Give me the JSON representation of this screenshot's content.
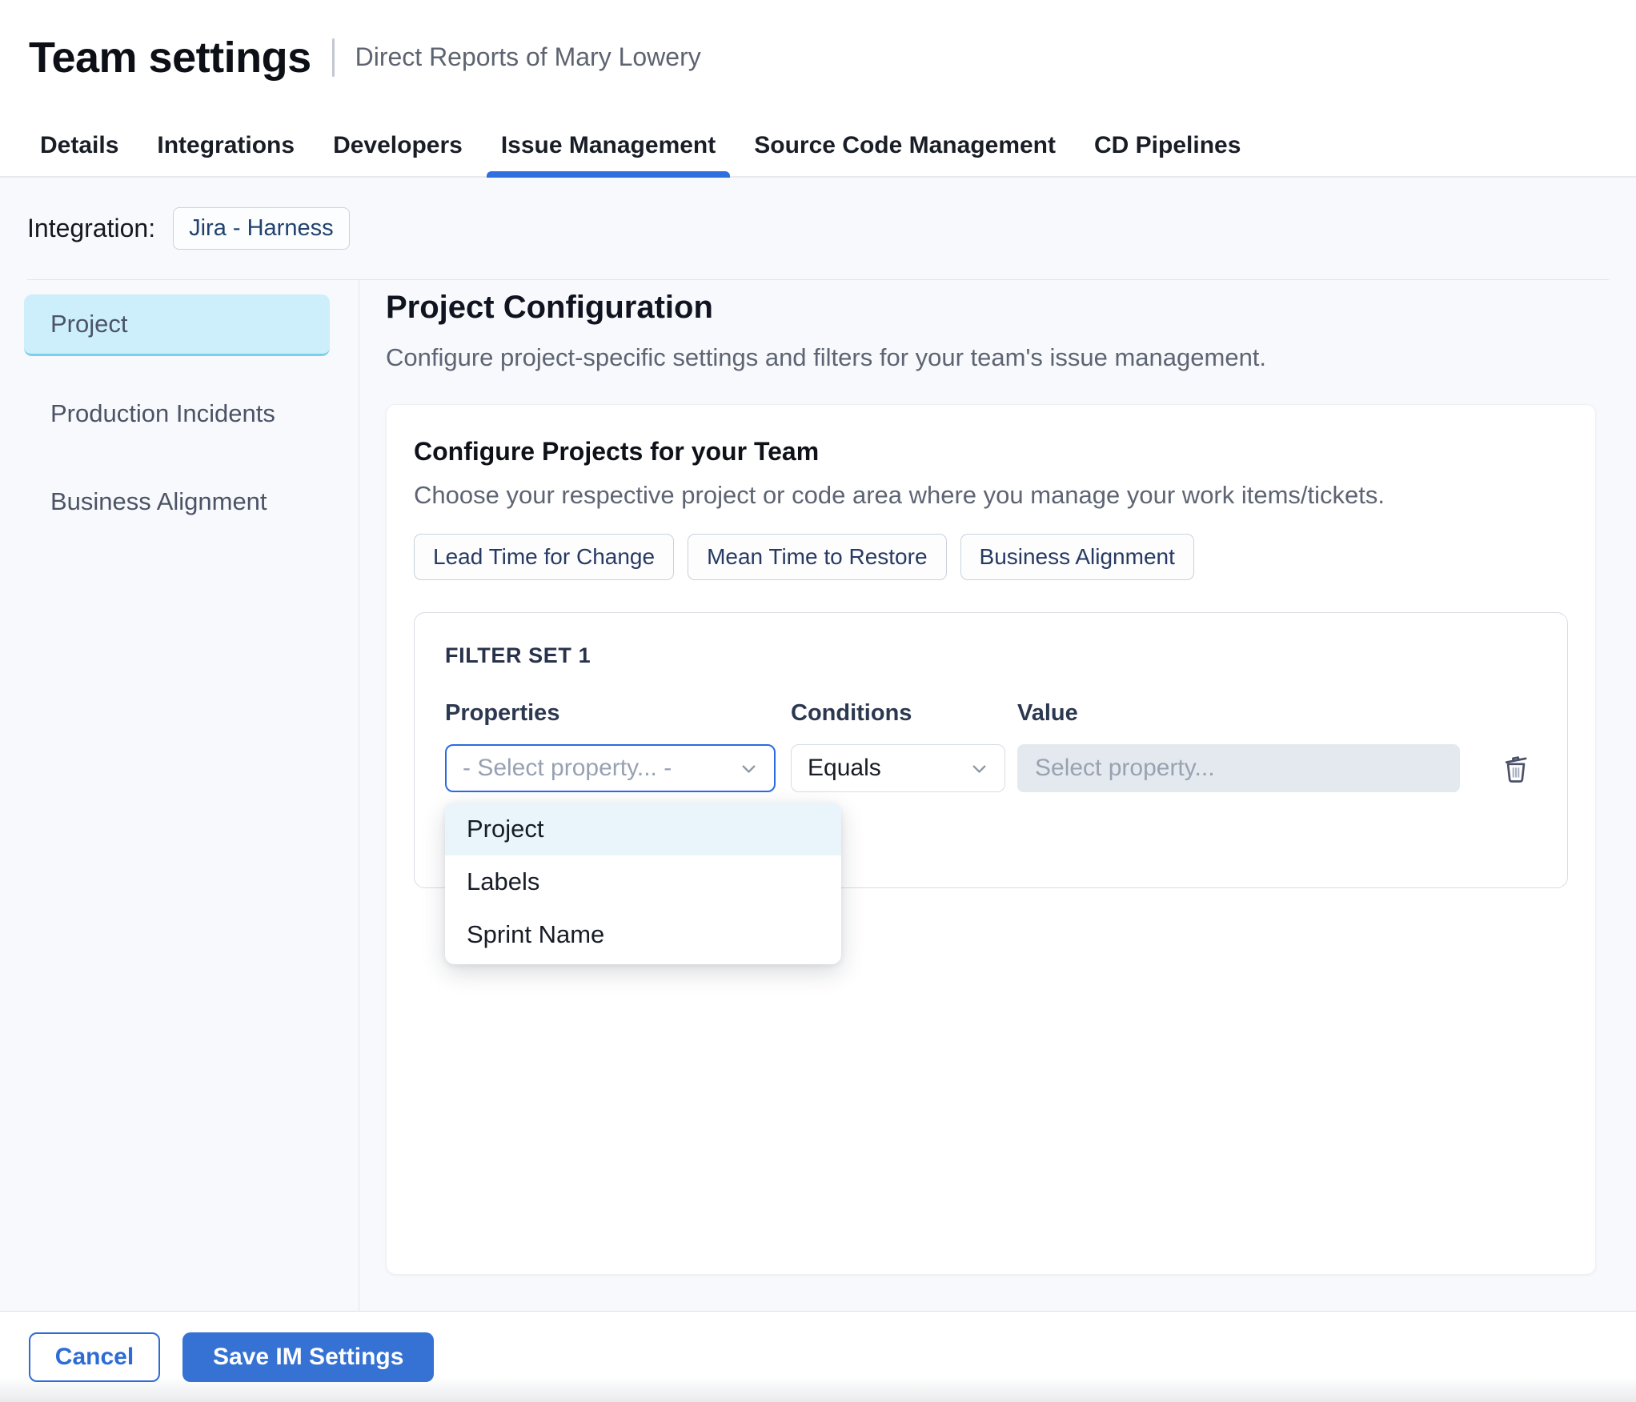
{
  "header": {
    "title": "Team settings",
    "subtitle": "Direct Reports of Mary Lowery"
  },
  "tabs": [
    {
      "label": "Details",
      "active": false
    },
    {
      "label": "Integrations",
      "active": false
    },
    {
      "label": "Developers",
      "active": false
    },
    {
      "label": "Issue Management",
      "active": true
    },
    {
      "label": "Source Code Management",
      "active": false
    },
    {
      "label": "CD Pipelines",
      "active": false
    }
  ],
  "integration": {
    "label": "Integration:",
    "chip": "Jira - Harness"
  },
  "sidebar": {
    "items": [
      {
        "label": "Project",
        "selected": true
      },
      {
        "label": "Production Incidents",
        "selected": false
      },
      {
        "label": "Business Alignment",
        "selected": false
      }
    ]
  },
  "main": {
    "heading": "Project Configuration",
    "description": "Configure project-specific settings and filters for your team's issue management.",
    "card": {
      "title": "Configure Projects for your Team",
      "description": "Choose your respective project or code area where you manage your work items/tickets.",
      "chips": [
        "Lead Time for Change",
        "Mean Time to Restore",
        "Business Alignment"
      ],
      "filter_set": {
        "title": "FILTER SET 1",
        "columns": {
          "properties": "Properties",
          "conditions": "Conditions",
          "value": "Value"
        },
        "property_placeholder": "- Select property... -",
        "condition_value": "Equals",
        "value_placeholder": "Select property...",
        "dropdown_options": [
          {
            "label": "Project",
            "highlighted": true
          },
          {
            "label": "Labels",
            "highlighted": false
          },
          {
            "label": "Sprint Name",
            "highlighted": false
          }
        ]
      }
    }
  },
  "footer": {
    "cancel_label": "Cancel",
    "save_label": "Save IM Settings"
  },
  "icons": {
    "chevron": "chevron-down-icon",
    "trash": "trash-icon"
  },
  "colors": {
    "accent_blue": "#2f6fe0",
    "button_blue": "#3572d3",
    "selected_sidebar_bg": "#cdeefb",
    "selected_sidebar_border": "#7bcfeb",
    "dropdown_highlight": "#eaf5fb",
    "disabled_input_bg": "#e4e9ef",
    "content_bg": "#f8f9fc",
    "chip_text": "#22426e"
  }
}
